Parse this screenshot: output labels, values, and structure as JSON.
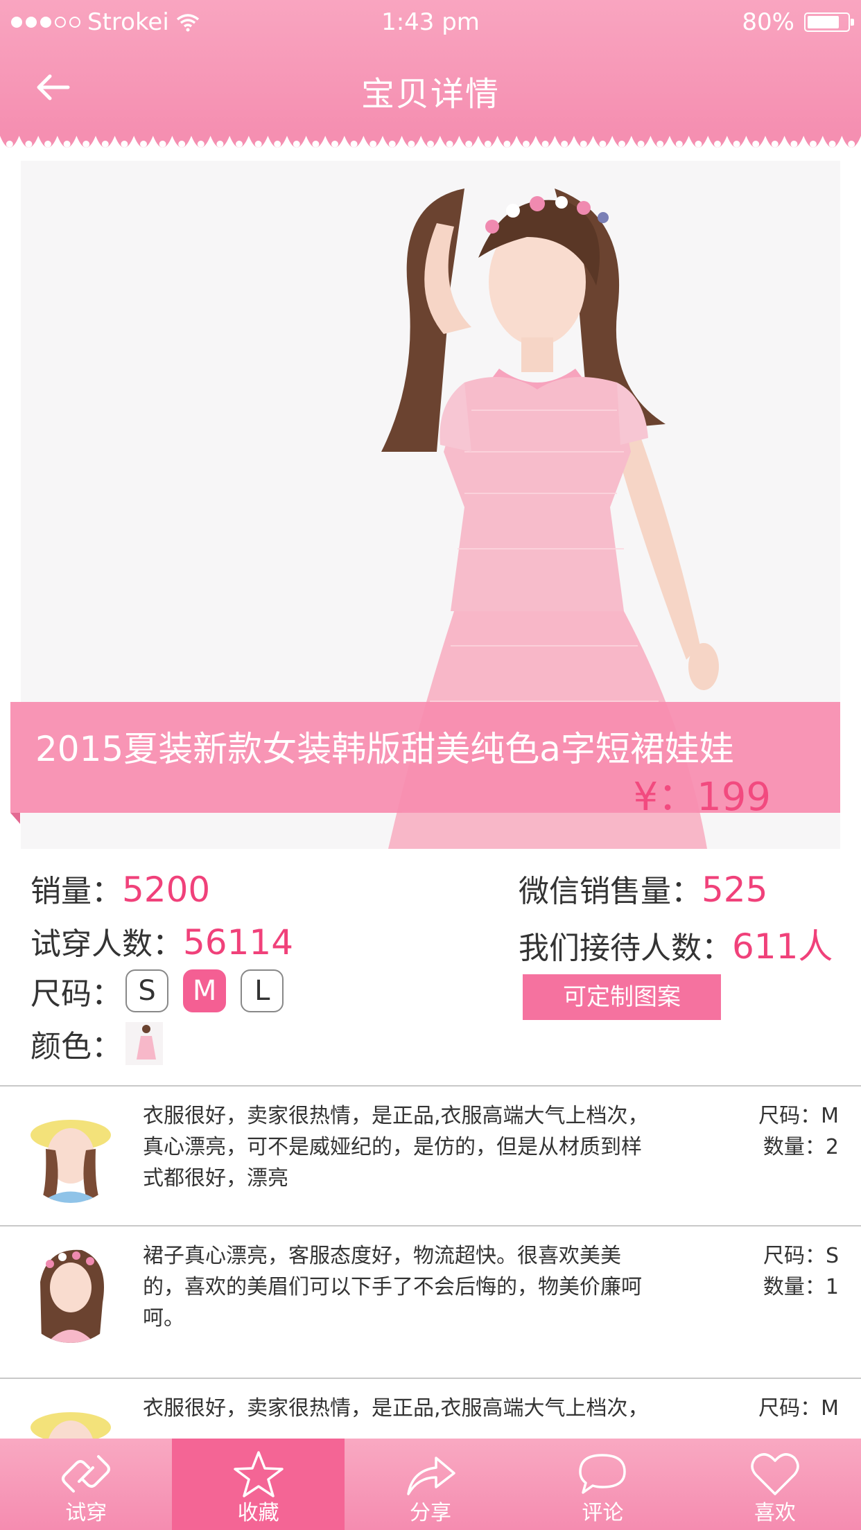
{
  "status_bar": {
    "carrier": "Strokei",
    "time": "1:43 pm",
    "battery": "80%",
    "battery_level": 0.8,
    "signal_bars_filled": 3,
    "signal_bars_total": 5
  },
  "header": {
    "title": "宝贝详情",
    "back_icon": "arrow-left-icon"
  },
  "product": {
    "name": "2015夏装新款女装韩版甜美纯色a字短裙娃娃",
    "price": "¥：199"
  },
  "stats": {
    "sales_label": "销量：",
    "sales_value": "5200",
    "wechat_label": "微信销售量：",
    "wechat_value": "525",
    "tryon_label": "试穿人数：",
    "tryon_value": "56114",
    "reception_label": "我们接待人数：",
    "reception_value": "611人",
    "size_label": "尺码：",
    "sizes": [
      "S",
      "M",
      "L"
    ],
    "selected_size": "M",
    "color_label": "颜色：",
    "custom_button": "可定制图案"
  },
  "reviews": [
    {
      "text": "衣服很好，卖家很热情，是正品,衣服高端大气上档次，真心漂亮，可不是威娅纪的，是仿的，但是从材质到样式都很好，漂亮",
      "size": "尺码：M",
      "qty": "数量：2"
    },
    {
      "text": "裙子真心漂亮，客服态度好，物流超快。很喜欢美美的，喜欢的美眉们可以下手了不会后悔的，物美价廉呵呵。",
      "size": "尺码：S",
      "qty": "数量：1"
    },
    {
      "text": "衣服很好，卖家很热情，是正品,衣服高端大气上档次，",
      "size": "尺码：M",
      "qty": ""
    }
  ],
  "tabs": [
    {
      "label": "试穿",
      "icon": "hanger-link-icon"
    },
    {
      "label": "收藏",
      "icon": "star-icon"
    },
    {
      "label": "分享",
      "icon": "share-arrow-icon"
    },
    {
      "label": "评论",
      "icon": "speech-bubble-icon"
    },
    {
      "label": "喜欢",
      "icon": "heart-icon"
    }
  ],
  "active_tab": "收藏",
  "colors": {
    "header_pink": "#f79cbb",
    "accent": "#f0417a",
    "button": "#f5729f",
    "active_tab": "#f46595"
  }
}
